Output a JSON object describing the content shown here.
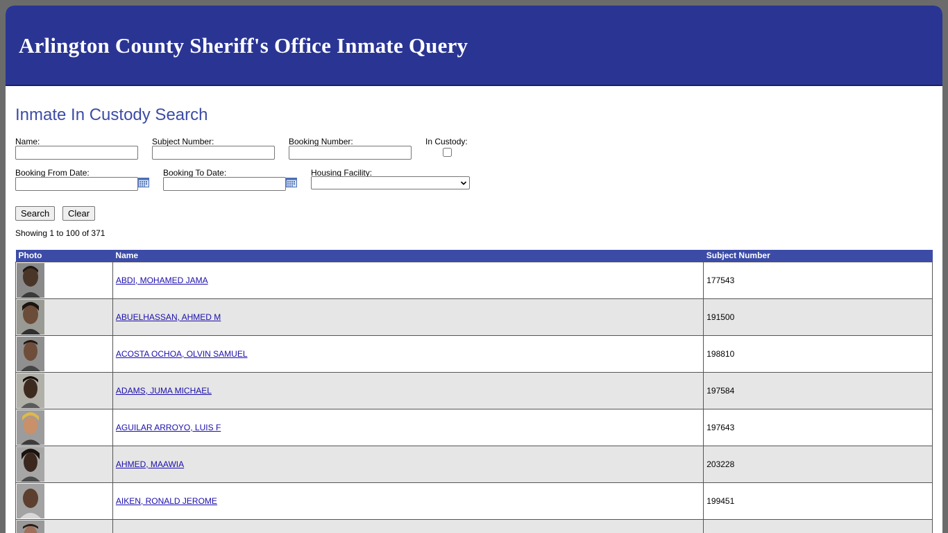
{
  "header": {
    "title": "Arlington County Sheriff's Office Inmate Query"
  },
  "search": {
    "heading": "Inmate In Custody Search",
    "name_label": "Name:",
    "name_value": "",
    "subject_label": "Subject Number:",
    "subject_value": "",
    "booking_label": "Booking Number:",
    "booking_value": "",
    "custody_label": "In Custody:",
    "from_date_label": "Booking From Date:",
    "from_date_value": "",
    "to_date_label": "Booking To Date:",
    "to_date_value": "",
    "facility_label": "Housing Facility:",
    "facility_value": "",
    "search_button": "Search",
    "clear_button": "Clear"
  },
  "results": {
    "showing": "Showing 1 to 100 of 371",
    "columns": [
      "Photo",
      "Name",
      "Subject Number"
    ],
    "rows": [
      {
        "name": "ABDI, MOHAMED JAMA",
        "subject": "177543"
      },
      {
        "name": "ABUELHASSAN, AHMED M",
        "subject": "191500"
      },
      {
        "name": "ACOSTA OCHOA, OLVIN SAMUEL",
        "subject": "198810"
      },
      {
        "name": "ADAMS, JUMA MICHAEL",
        "subject": "197584"
      },
      {
        "name": "AGUILAR ARROYO, LUIS F",
        "subject": "197643"
      },
      {
        "name": "AHMED, MAAWIA",
        "subject": "203228"
      },
      {
        "name": "AIKEN, RONALD JEROME",
        "subject": "199451"
      },
      {
        "name": "",
        "subject": ""
      }
    ]
  },
  "icons": {
    "calendar": "calendar-icon",
    "chevron": "chevron-down-icon",
    "photo": "mugshot-photo"
  },
  "colors": {
    "banner": "#2a3593",
    "accent": "#3c4ca6",
    "row_alt": "#e6e6e6",
    "link": "#1a0dab"
  }
}
